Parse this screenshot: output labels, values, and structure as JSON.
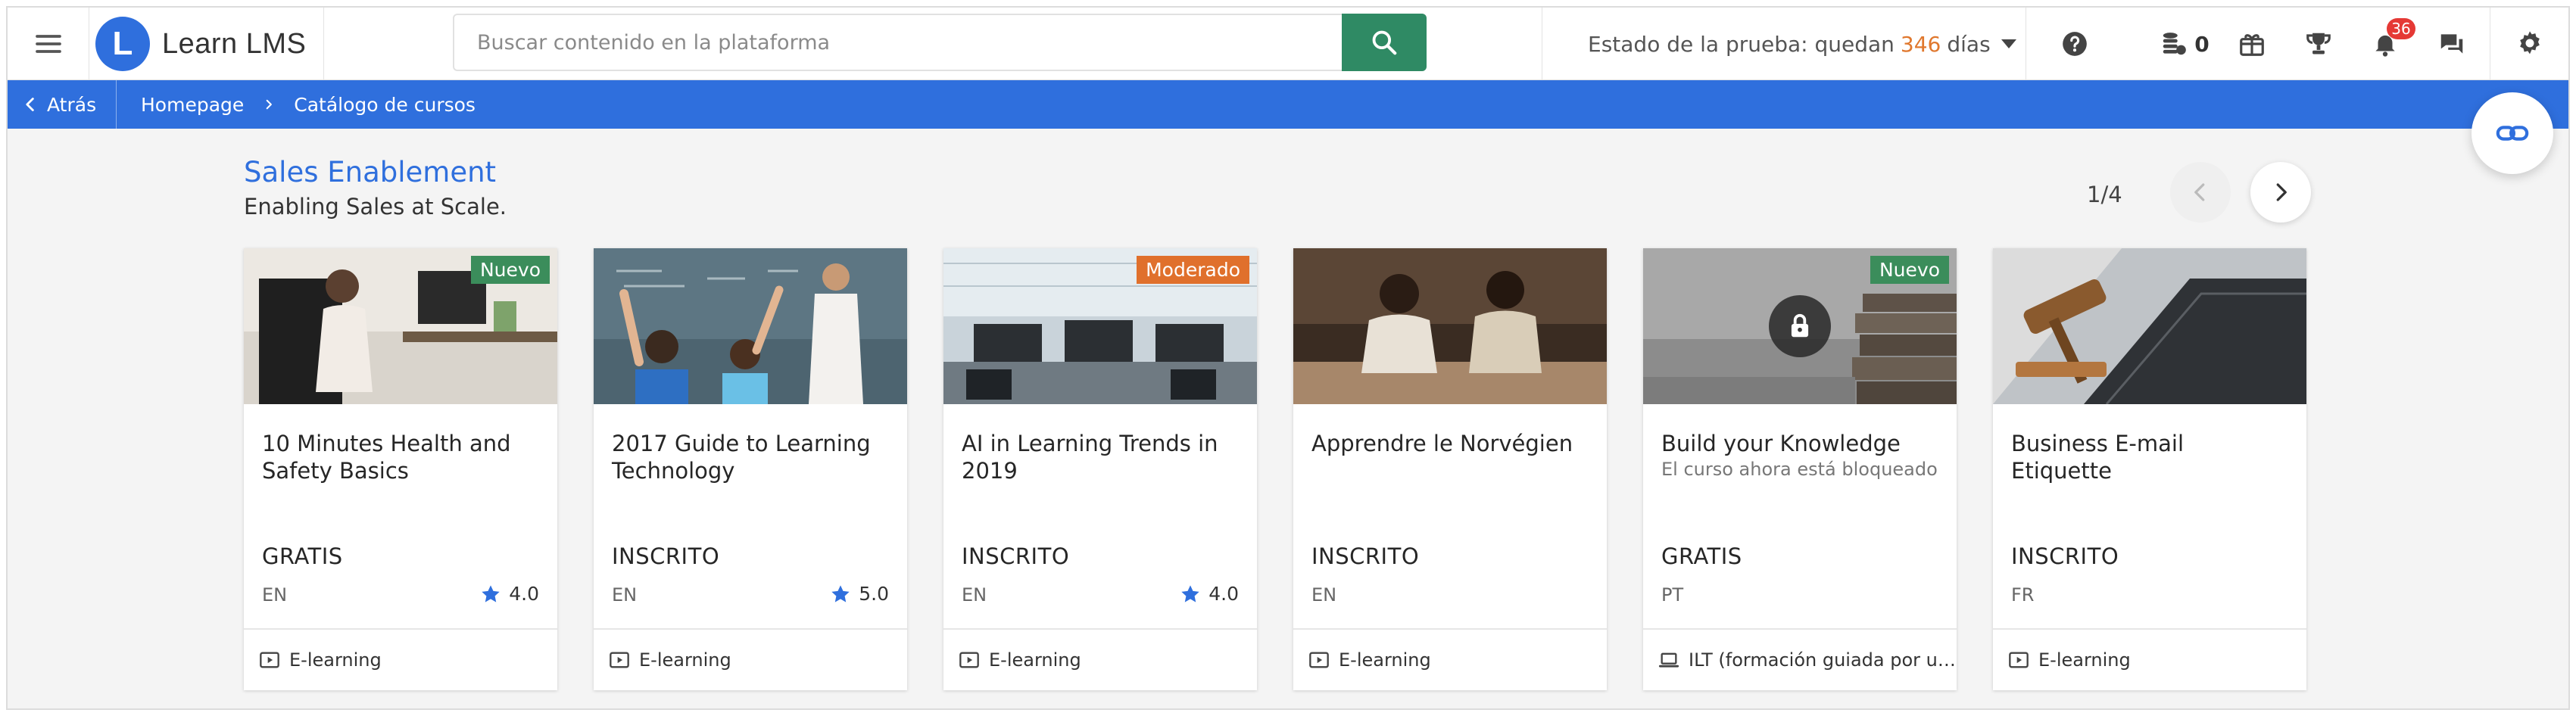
{
  "app": {
    "brand_letter": "L",
    "brand_name": "Learn LMS"
  },
  "search": {
    "placeholder": "Buscar contenido en la plataforma",
    "value": ""
  },
  "trial": {
    "prefix": "Estado de la prueba: quedan",
    "days": "346",
    "suffix": "días"
  },
  "toolbar": {
    "coins_count": "0",
    "notifications_count": "36"
  },
  "breadcrumb": {
    "back_label": "Atrás",
    "items": [
      "Homepage",
      "Catálogo de cursos"
    ]
  },
  "section": {
    "title": "Sales Enablement",
    "subtitle": "Enabling Sales at Scale.",
    "pager": "1/4"
  },
  "cards": [
    {
      "title": "10 Minutes Health and Safety Basics",
      "badge": "Nuevo",
      "status": "GRATIS",
      "lang": "EN",
      "rating": "4.0",
      "type": "E-learning",
      "type_icon": "play-icon"
    },
    {
      "title": "2017 Guide to Learning Technology",
      "badge": "",
      "status": "INSCRITO",
      "lang": "EN",
      "rating": "5.0",
      "type": "E-learning",
      "type_icon": "play-icon"
    },
    {
      "title": "AI in Learning Trends in 2019",
      "badge": "Moderado",
      "status": "INSCRITO",
      "lang": "EN",
      "rating": "4.0",
      "type": "E-learning",
      "type_icon": "play-icon"
    },
    {
      "title": "Apprendre le Norvégien",
      "badge": "",
      "status": "INSCRITO",
      "lang": "EN",
      "rating": "",
      "type": "E-learning",
      "type_icon": "play-icon"
    },
    {
      "title": "Build your Knowledge",
      "subtitle": "El curso ahora está bloqueado",
      "badge": "Nuevo",
      "status": "GRATIS",
      "lang": "PT",
      "rating": "",
      "type": "ILT (formación guiada por un instructor)",
      "type_icon": "laptop-icon"
    },
    {
      "title": "Business E-mail Etiquette",
      "badge": "",
      "status": "INSCRITO",
      "lang": "FR",
      "rating": "",
      "type": "E-learning",
      "type_icon": "play-icon"
    }
  ],
  "colors": {
    "primary": "#2f6fdd",
    "search_button": "#2f8a64",
    "badge_new": "#3b8d5b",
    "badge_moderated": "#e0702c",
    "trial_days": "#e0782e",
    "notification_badge": "#e53935"
  }
}
